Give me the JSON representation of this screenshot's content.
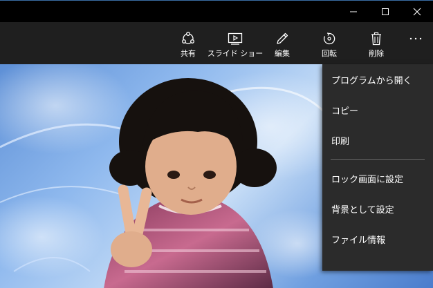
{
  "titlebar": {
    "buttons": [
      {
        "name": "minimize",
        "icon": "minimize-icon"
      },
      {
        "name": "maximize",
        "icon": "maximize-icon"
      },
      {
        "name": "close",
        "icon": "close-icon"
      }
    ]
  },
  "commandbar": {
    "share_label": "共有",
    "slideshow_label": "スライド ショー",
    "edit_label": "編集",
    "rotate_label": "回転",
    "delete_label": "削除",
    "icons": {
      "share": "share-icon",
      "slideshow": "slideshow-icon",
      "edit": "pencil-icon",
      "rotate": "rotate-icon",
      "delete": "trash-icon",
      "more": "more-icon"
    }
  },
  "menu": {
    "items": [
      {
        "label": "プログラムから開く"
      },
      {
        "label": "コピー"
      },
      {
        "label": "印刷"
      },
      {
        "label": "ロック画面に設定"
      },
      {
        "label": "背景として設定"
      },
      {
        "label": "ファイル情報"
      }
    ]
  },
  "colors": {
    "titlebar": "#000000",
    "commandbar": "#1f1f1f",
    "menu": "#2b2b2b",
    "text": "#ffffff"
  }
}
